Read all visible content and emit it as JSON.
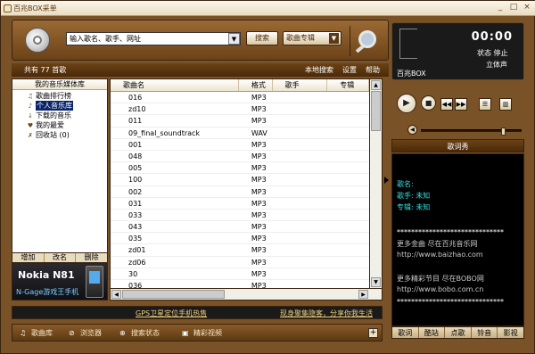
{
  "window": {
    "title": "百兆BOX采单",
    "minimize": "_",
    "maximize": "□",
    "close": "×"
  },
  "search": {
    "placeholder": "输入歌名、歌手、网址",
    "dropdown": "▼",
    "search_label": "搜索",
    "zone_label": "歌曲专辑",
    "zone_dd": "▼"
  },
  "status": {
    "count": "共有 77 首歌",
    "links": [
      "本地搜索",
      "设置",
      "帮助"
    ]
  },
  "library": {
    "header": "我的音乐媒体库",
    "items": [
      {
        "icon": "♫",
        "label": "歌曲排行榜"
      },
      {
        "icon": "♪",
        "label": "个人音乐库"
      },
      {
        "icon": "↓",
        "label": "下载的音乐"
      },
      {
        "icon": "♥",
        "label": "我的最爱"
      },
      {
        "icon": "✗",
        "label": "回收站 (0)"
      }
    ],
    "buttons": [
      "增加",
      "改名",
      "删除"
    ]
  },
  "ad_box": {
    "title": "Nokia N81",
    "subtitle": "N-Gage游戏王手机"
  },
  "table": {
    "headers": [
      "歌曲名",
      "格式",
      "歌手",
      "专辑"
    ],
    "rows": [
      {
        "name": "016",
        "format": "MP3"
      },
      {
        "name": "zd10",
        "format": "MP3"
      },
      {
        "name": "011",
        "format": "MP3"
      },
      {
        "name": "09_final_soundtrack",
        "format": "WAV"
      },
      {
        "name": "001",
        "format": "MP3"
      },
      {
        "name": "048",
        "format": "MP3"
      },
      {
        "name": "005",
        "format": "MP3"
      },
      {
        "name": "100",
        "format": "MP3"
      },
      {
        "name": "002",
        "format": "MP3"
      },
      {
        "name": "031",
        "format": "MP3"
      },
      {
        "name": "033",
        "format": "MP3"
      },
      {
        "name": "043",
        "format": "MP3"
      },
      {
        "name": "035",
        "format": "MP3"
      },
      {
        "name": "zd01",
        "format": "MP3"
      },
      {
        "name": "zd06",
        "format": "MP3"
      },
      {
        "name": "30",
        "format": "MP3"
      },
      {
        "name": "036",
        "format": "MP3"
      }
    ]
  },
  "ads": {
    "left": "GPS卫星定位手机热售",
    "right": "现身聚集隐客，分享你我生活"
  },
  "bottom": [
    {
      "icon": "♫",
      "label": "歌曲库"
    },
    {
      "icon": "⊘",
      "label": "浏览器"
    },
    {
      "icon": "⊕",
      "label": "搜索状态"
    },
    {
      "icon": "▣",
      "label": "精彩视频"
    }
  ],
  "bottom_plus": "+",
  "player": {
    "time": "00:00",
    "state": "状态 停止",
    "stereo": "立体声",
    "brand": "百兆BOX",
    "volume": 0.82,
    "buttons": {
      "play": "▶",
      "stop": "■",
      "prev": "◀◀",
      "next": "▶▶",
      "list": "☰",
      "eq": "▥",
      "mute": "◀"
    }
  },
  "lyrics": {
    "title": "歌词秀",
    "lines": [
      {
        "text": "歌名:",
        "color": "#33e0e0"
      },
      {
        "text": "歌手: 未知",
        "color": "#33e0e0"
      },
      {
        "text": "专辑: 未知",
        "color": "#33e0e0"
      },
      {
        "text": "******************************",
        "color": "#ffffff"
      },
      {
        "text": "更多金曲 尽在百兆音乐网",
        "color": "#c8c8c8"
      },
      {
        "text": "http://www.baizhao.com",
        "color": "#c8c8c8"
      },
      {
        "text": "更多精彩节目 尽在BOBO网",
        "color": "#c8c8c8"
      },
      {
        "text": "http://www.bobo.com.cn",
        "color": "#c8c8c8"
      },
      {
        "text": "******************************",
        "color": "#ffffff"
      }
    ]
  },
  "right_tabs": [
    "歌词",
    "酷站",
    "点歌",
    "铃音",
    "影视"
  ]
}
